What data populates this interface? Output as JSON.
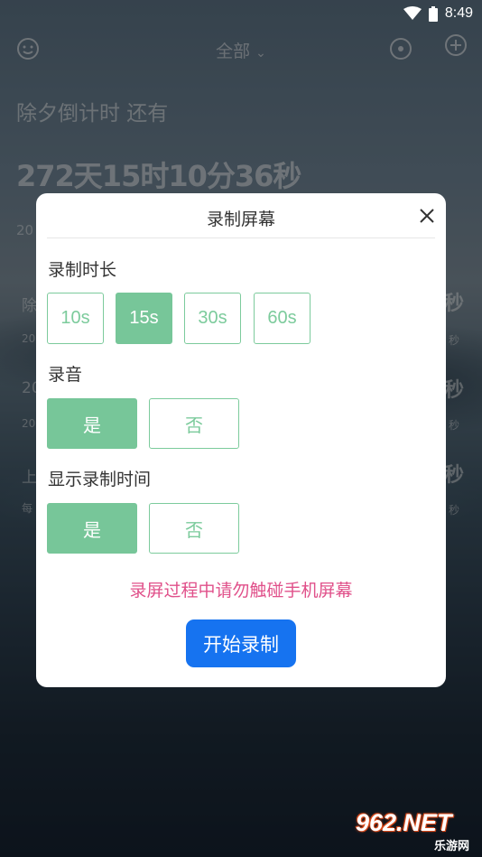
{
  "status_bar": {
    "time": "8:49"
  },
  "header": {
    "title": "全部"
  },
  "background": {
    "countdown_title": "除夕倒计时 还有",
    "countdown_value": "272天15时10分36秒",
    "row_year_1": "20",
    "row2_title": "除",
    "row2_date": "20",
    "row3_title": "20",
    "row3_date": "20",
    "row4_title": "上",
    "row4_date": "每",
    "right_label": "秒",
    "right_small": "秒"
  },
  "dialog": {
    "title": "录制屏幕",
    "duration_label": "录制时长",
    "durations": [
      "10s",
      "15s",
      "30s",
      "60s"
    ],
    "duration_selected": "15s",
    "audio_label": "录音",
    "audio_yes": "是",
    "audio_no": "否",
    "audio_selected": "是",
    "show_time_label": "显示录制时间",
    "show_time_yes": "是",
    "show_time_no": "否",
    "show_time_selected": "是",
    "warning": "录屏过程中请勿触碰手机屏幕",
    "start_button": "开始录制"
  },
  "watermark": {
    "main": "962.NET",
    "sub": "乐游网"
  },
  "colors": {
    "accent_green": "#77c699",
    "primary_blue": "#1673f0",
    "warning_pink": "#e0508a"
  }
}
